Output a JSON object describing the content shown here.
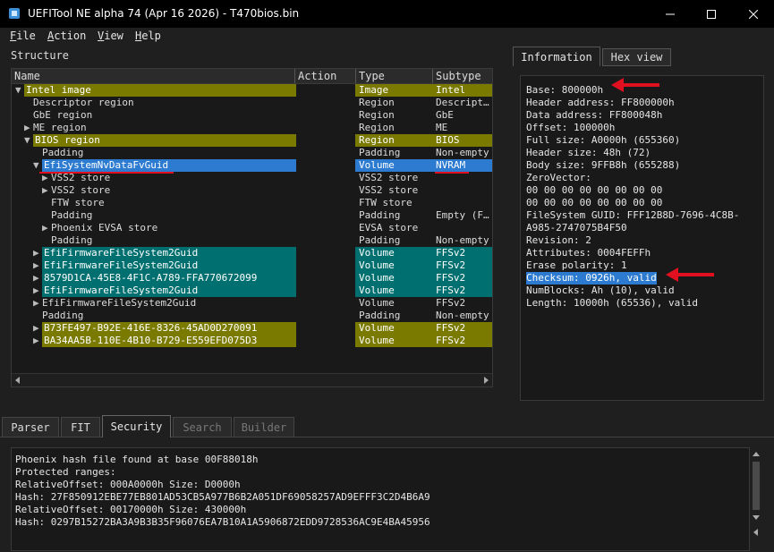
{
  "window": {
    "title": "UEFITool NE alpha 74 (Apr 16 2026) - T470bios.bin"
  },
  "menu": [
    {
      "hot": "F",
      "rest": "ile"
    },
    {
      "hot": "A",
      "rest": "ction"
    },
    {
      "hot": "V",
      "rest": "iew"
    },
    {
      "hot": "H",
      "rest": "elp"
    }
  ],
  "structure": {
    "label": "Structure",
    "columns": {
      "name": "Name",
      "action": "Action",
      "type": "Type",
      "subtype": "Subtype"
    },
    "rows": [
      {
        "name": "Intel image",
        "action": "",
        "type": "Image",
        "subtype": "Intel",
        "indent": 0,
        "arrow": "▼",
        "hl": "olive"
      },
      {
        "name": "Descriptor region",
        "action": "",
        "type": "Region",
        "subtype": "Descript…",
        "indent": 1,
        "arrow": "",
        "hl": ""
      },
      {
        "name": "GbE region",
        "action": "",
        "type": "Region",
        "subtype": "GbE",
        "indent": 1,
        "arrow": "",
        "hl": ""
      },
      {
        "name": "ME region",
        "action": "",
        "type": "Region",
        "subtype": "ME",
        "indent": 1,
        "arrow": "▶",
        "hl": ""
      },
      {
        "name": "BIOS region",
        "action": "",
        "type": "Region",
        "subtype": "BIOS",
        "indent": 1,
        "arrow": "▼",
        "hl": "olive"
      },
      {
        "name": "Padding",
        "action": "",
        "type": "Padding",
        "subtype": "Non-empty",
        "indent": 2,
        "arrow": "",
        "hl": ""
      },
      {
        "name": "EfiSystemNvDataFvGuid",
        "action": "",
        "type": "Volume",
        "subtype": "NVRAM",
        "indent": 2,
        "arrow": "▼",
        "hl": "sel"
      },
      {
        "name": "VSS2 store",
        "action": "",
        "type": "VSS2 store",
        "subtype": "",
        "indent": 3,
        "arrow": "▶",
        "hl": ""
      },
      {
        "name": "VSS2 store",
        "action": "",
        "type": "VSS2 store",
        "subtype": "",
        "indent": 3,
        "arrow": "▶",
        "hl": ""
      },
      {
        "name": "FTW store",
        "action": "",
        "type": "FTW store",
        "subtype": "",
        "indent": 3,
        "arrow": "",
        "hl": ""
      },
      {
        "name": "Padding",
        "action": "",
        "type": "Padding",
        "subtype": "Empty (F…",
        "indent": 3,
        "arrow": "",
        "hl": ""
      },
      {
        "name": "Phoenix EVSA store",
        "action": "",
        "type": "EVSA store",
        "subtype": "",
        "indent": 3,
        "arrow": "▶",
        "hl": ""
      },
      {
        "name": "Padding",
        "action": "",
        "type": "Padding",
        "subtype": "Non-empty",
        "indent": 3,
        "arrow": "",
        "hl": ""
      },
      {
        "name": "EfiFirmwareFileSystem2Guid",
        "action": "",
        "type": "Volume",
        "subtype": "FFSv2",
        "indent": 2,
        "arrow": "▶",
        "hl": "teal"
      },
      {
        "name": "EfiFirmwareFileSystem2Guid",
        "action": "",
        "type": "Volume",
        "subtype": "FFSv2",
        "indent": 2,
        "arrow": "▶",
        "hl": "teal"
      },
      {
        "name": "8579D1CA-45E8-4F1C-A789-FFA770672099",
        "action": "",
        "type": "Volume",
        "subtype": "FFSv2",
        "indent": 2,
        "arrow": "▶",
        "hl": "teal"
      },
      {
        "name": "EfiFirmwareFileSystem2Guid",
        "action": "",
        "type": "Volume",
        "subtype": "FFSv2",
        "indent": 2,
        "arrow": "▶",
        "hl": "teal"
      },
      {
        "name": "EfiFirmwareFileSystem2Guid",
        "action": "",
        "type": "Volume",
        "subtype": "FFSv2",
        "indent": 2,
        "arrow": "▶",
        "hl": ""
      },
      {
        "name": "Padding",
        "action": "",
        "type": "Padding",
        "subtype": "Non-empty",
        "indent": 2,
        "arrow": "",
        "hl": ""
      },
      {
        "name": "B73FE497-B92E-416E-8326-45AD0D270091",
        "action": "",
        "type": "Volume",
        "subtype": "FFSv2",
        "indent": 2,
        "arrow": "▶",
        "hl": "olive"
      },
      {
        "name": "BA34AA5B-110E-4B10-B729-E559EFD075D3",
        "action": "",
        "type": "Volume",
        "subtype": "FFSv2",
        "indent": 2,
        "arrow": "▶",
        "hl": "olive"
      }
    ]
  },
  "info_tabs": {
    "information": "Information",
    "hex_view": "Hex view"
  },
  "information": [
    "Base: 800000h",
    "Header address: FF800000h",
    "Data address: FF800048h",
    "Offset: 100000h",
    "Full size: A0000h (655360)",
    "Header size: 48h (72)",
    "Body size: 9FFB8h (655288)",
    "ZeroVector:",
    "00 00 00 00 00 00 00 00",
    "00 00 00 00 00 00 00 00",
    "FileSystem GUID: FFF12B8D-7696-4C8B-",
    "A985-2747075B4F50",
    "Revision: 2",
    "Attributes: 0004FEFFh",
    "Erase polarity: 1",
    "Checksum: 0926h, valid",
    "NumBlocks: Ah (10), valid",
    "Length: 10000h (65536), valid"
  ],
  "bottom_tabs": [
    "Parser",
    "FIT",
    "Security",
    "Search",
    "Builder"
  ],
  "log": [
    "Phoenix hash file found at base 00F88018h",
    "Protected ranges:",
    "RelativeOffset: 000A0000h Size: D0000h",
    "Hash: 27F850912EBE77EB801AD53CB5A977B6B2A051DF69058257AD9EFFF3C2D4B6A9",
    "RelativeOffset: 00170000h Size: 430000h",
    "Hash: 0297B15272BA3A9B3B35F96076EA7B10A1A5906872EDD9728536AC9E4BA45956"
  ],
  "colors": {
    "olive": "#7a7a00",
    "teal": "#006f6f",
    "selection": "#2c7bd1",
    "annotation": "#e01020"
  }
}
